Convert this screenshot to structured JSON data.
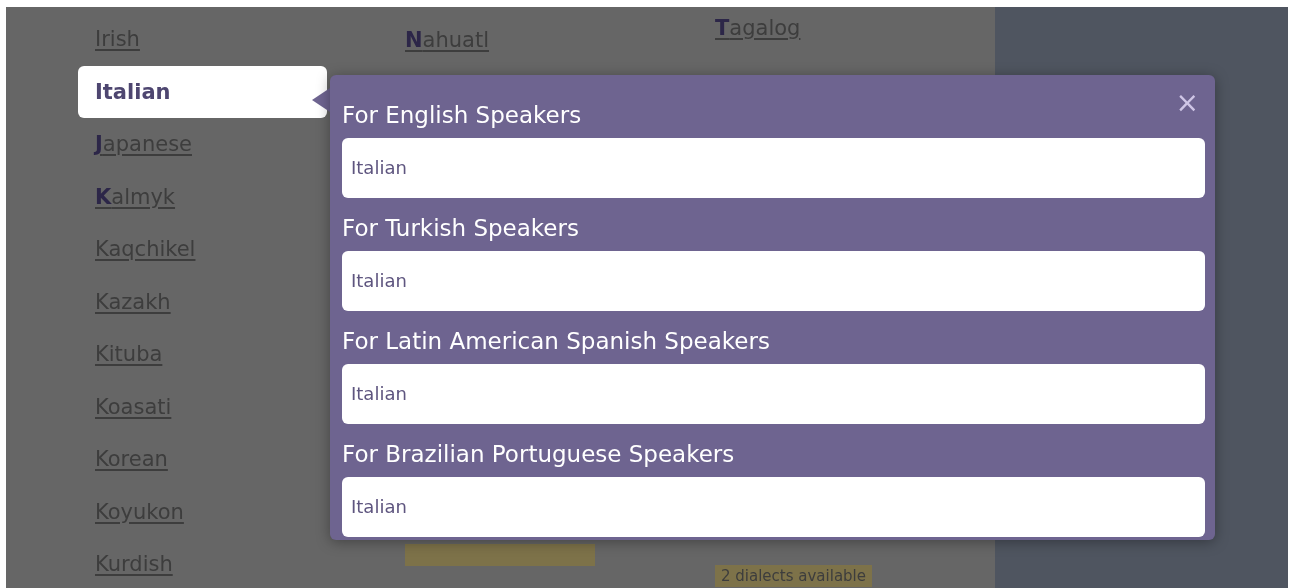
{
  "columns": [
    {
      "items": [
        {
          "kind": "link",
          "label": "Irish",
          "selected": false
        },
        {
          "kind": "link",
          "label": "Italian",
          "selected": true
        },
        {
          "kind": "link",
          "label": "**J**apanese",
          "selected": false
        },
        {
          "kind": "link",
          "label": "**K**almyk",
          "selected": false
        },
        {
          "kind": "link",
          "label": "Kaqchikel",
          "selected": false
        },
        {
          "kind": "link",
          "label": "Kazakh",
          "selected": false
        },
        {
          "kind": "link",
          "label": "Kituba",
          "selected": false
        },
        {
          "kind": "link",
          "label": "Koasati",
          "selected": false
        },
        {
          "kind": "link",
          "label": "Korean",
          "selected": false
        },
        {
          "kind": "link",
          "label": "Koyukon",
          "selected": false
        },
        {
          "kind": "link",
          "label": "Kurdish",
          "selected": false
        }
      ]
    },
    {
      "items": [
        {
          "kind": "link",
          "label": "**N**ahuatl",
          "selected": false
        },
        {
          "kind": "gap"
        },
        {
          "kind": "tag"
        }
      ]
    },
    {
      "items": [
        {
          "kind": "link",
          "label": "**T**agalog",
          "selected": false
        },
        {
          "kind": "gap"
        },
        {
          "kind": "tag",
          "label": "2 dialects available"
        }
      ]
    }
  ],
  "popup": {
    "close": "×",
    "sections": [
      {
        "heading": "For English Speakers",
        "options": [
          {
            "label": "Italian"
          }
        ]
      },
      {
        "heading": "For Turkish Speakers",
        "options": [
          {
            "label": "Italian"
          }
        ]
      },
      {
        "heading": "For Latin American Spanish Speakers",
        "options": [
          {
            "label": "Italian"
          }
        ]
      },
      {
        "heading": "For Brazilian Portuguese Speakers",
        "options": [
          {
            "label": "Italian"
          }
        ]
      }
    ]
  }
}
